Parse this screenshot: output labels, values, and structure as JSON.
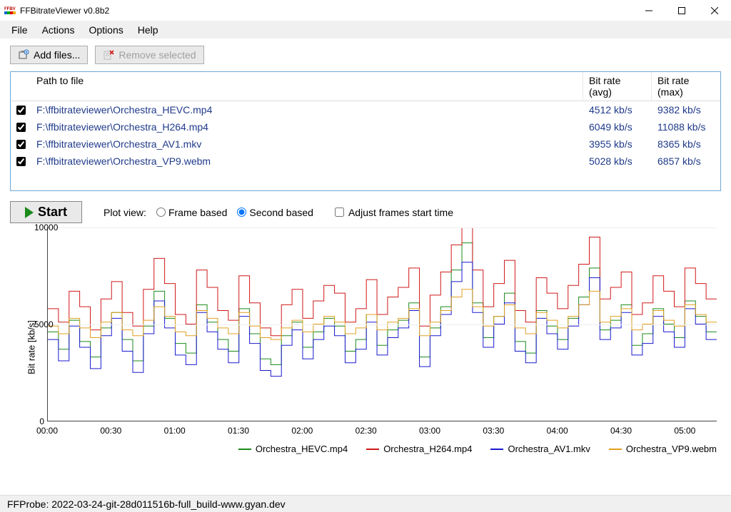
{
  "window": {
    "title": "FFBitrateViewer v0.8b2"
  },
  "menu": {
    "items": [
      "File",
      "Actions",
      "Options",
      "Help"
    ]
  },
  "toolbar": {
    "add_label": "Add files...",
    "remove_label": "Remove selected"
  },
  "filelist": {
    "headers": {
      "path": "Path to file",
      "avg": "Bit rate (avg)",
      "max": "Bit rate (max)"
    },
    "rows": [
      {
        "checked": true,
        "path": "F:\\ffbitrateviewer\\Orchestra_HEVC.mp4",
        "avg": "4512 kb/s",
        "max": "9382 kb/s"
      },
      {
        "checked": true,
        "path": "F:\\ffbitrateviewer\\Orchestra_H264.mp4",
        "avg": "6049 kb/s",
        "max": "11088 kb/s"
      },
      {
        "checked": true,
        "path": "F:\\ffbitrateviewer\\Orchestra_AV1.mkv",
        "avg": "3955 kb/s",
        "max": "8365 kb/s"
      },
      {
        "checked": true,
        "path": "F:\\ffbitrateviewer\\Orchestra_VP9.webm",
        "avg": "5028 kb/s",
        "max": "6857 kb/s"
      }
    ]
  },
  "controls": {
    "start_label": "Start",
    "plot_view_label": "Plot view:",
    "frame_label": "Frame based",
    "second_label": "Second based",
    "adjust_label": "Adjust frames start time",
    "plot_view_selected": "second"
  },
  "chart_data": {
    "type": "line",
    "ylabel": "Bit rate [kb/s]",
    "ylim": [
      0,
      10000
    ],
    "yticks": [
      0,
      5000,
      10000
    ],
    "xticks": [
      "00:00",
      "00:30",
      "01:00",
      "01:30",
      "02:00",
      "02:30",
      "03:00",
      "03:30",
      "04:00",
      "04:30",
      "05:00"
    ],
    "x_seconds_max": 315,
    "series": [
      {
        "name": "Orchestra_HEVC.mp4",
        "color": "#1a8a1a",
        "values": [
          4600,
          3700,
          5200,
          4100,
          3300,
          4800,
          5600,
          4200,
          3100,
          4900,
          6700,
          5300,
          4000,
          3500,
          6000,
          5100,
          4200,
          3600,
          5800,
          4500,
          3200,
          2900,
          4400,
          5100,
          3800,
          4600,
          5300,
          4900,
          3600,
          4200,
          5500,
          3900,
          4700,
          5200,
          6100,
          3300,
          4800,
          5900,
          7800,
          9200,
          6100,
          4300,
          5400,
          6600,
          4100,
          3500,
          5700,
          4900,
          4200,
          5300,
          6400,
          7900,
          4700,
          5200,
          6000,
          3900,
          4500,
          5800,
          5000,
          4300,
          6200,
          5400,
          4600
        ]
      },
      {
        "name": "Orchestra_H264.mp4",
        "color": "#d01818",
        "values": [
          5800,
          5100,
          6700,
          5900,
          4700,
          6300,
          7200,
          5600,
          4900,
          6800,
          8400,
          7100,
          5500,
          5000,
          7800,
          6900,
          5700,
          5200,
          7500,
          6100,
          4800,
          4400,
          6000,
          6800,
          5300,
          6200,
          7000,
          6600,
          5100,
          5800,
          7300,
          5500,
          6400,
          6900,
          7900,
          4900,
          6500,
          7700,
          9100,
          10000,
          7800,
          5900,
          7100,
          8300,
          5700,
          5100,
          7400,
          6600,
          5800,
          7000,
          8100,
          9500,
          6300,
          6900,
          7700,
          5500,
          6100,
          7500,
          6700,
          5900,
          7900,
          7100,
          6300
        ]
      },
      {
        "name": "Orchestra_AV1.mkv",
        "color": "#1a1ad0",
        "values": [
          4200,
          3100,
          4900,
          3800,
          2700,
          4400,
          5300,
          3600,
          2500,
          4500,
          6200,
          4800,
          3400,
          2900,
          5600,
          4600,
          3700,
          3000,
          5400,
          4000,
          2600,
          2300,
          3900,
          4700,
          3200,
          4200,
          4900,
          4400,
          3000,
          3700,
          5100,
          3400,
          4300,
          4800,
          5700,
          2800,
          4400,
          5500,
          7200,
          8200,
          5600,
          3800,
          5000,
          6100,
          3600,
          3000,
          5300,
          4500,
          3700,
          4900,
          6000,
          7400,
          4200,
          4800,
          5600,
          3400,
          4000,
          5400,
          4600,
          3800,
          5800,
          5000,
          4200
        ]
      },
      {
        "name": "Orchestra_VP9.webm",
        "color": "#e0a020",
        "values": [
          4900,
          4500,
          5300,
          4800,
          4300,
          5100,
          5600,
          4700,
          4400,
          5200,
          5900,
          5400,
          4600,
          4400,
          5700,
          5300,
          4800,
          4500,
          5600,
          4900,
          4300,
          4200,
          4800,
          5200,
          4600,
          5000,
          5400,
          5100,
          4500,
          4800,
          5500,
          4700,
          5100,
          5300,
          5800,
          4400,
          5100,
          5700,
          6400,
          6800,
          5900,
          4900,
          5400,
          6000,
          4800,
          4500,
          5600,
          5200,
          4800,
          5400,
          6000,
          6700,
          5100,
          5400,
          5800,
          4700,
          5000,
          5700,
          5200,
          4900,
          6000,
          5500,
          5100
        ]
      }
    ]
  },
  "status": {
    "text": "FFProbe: 2022-03-24-git-28d011516b-full_build-www.gyan.dev"
  }
}
